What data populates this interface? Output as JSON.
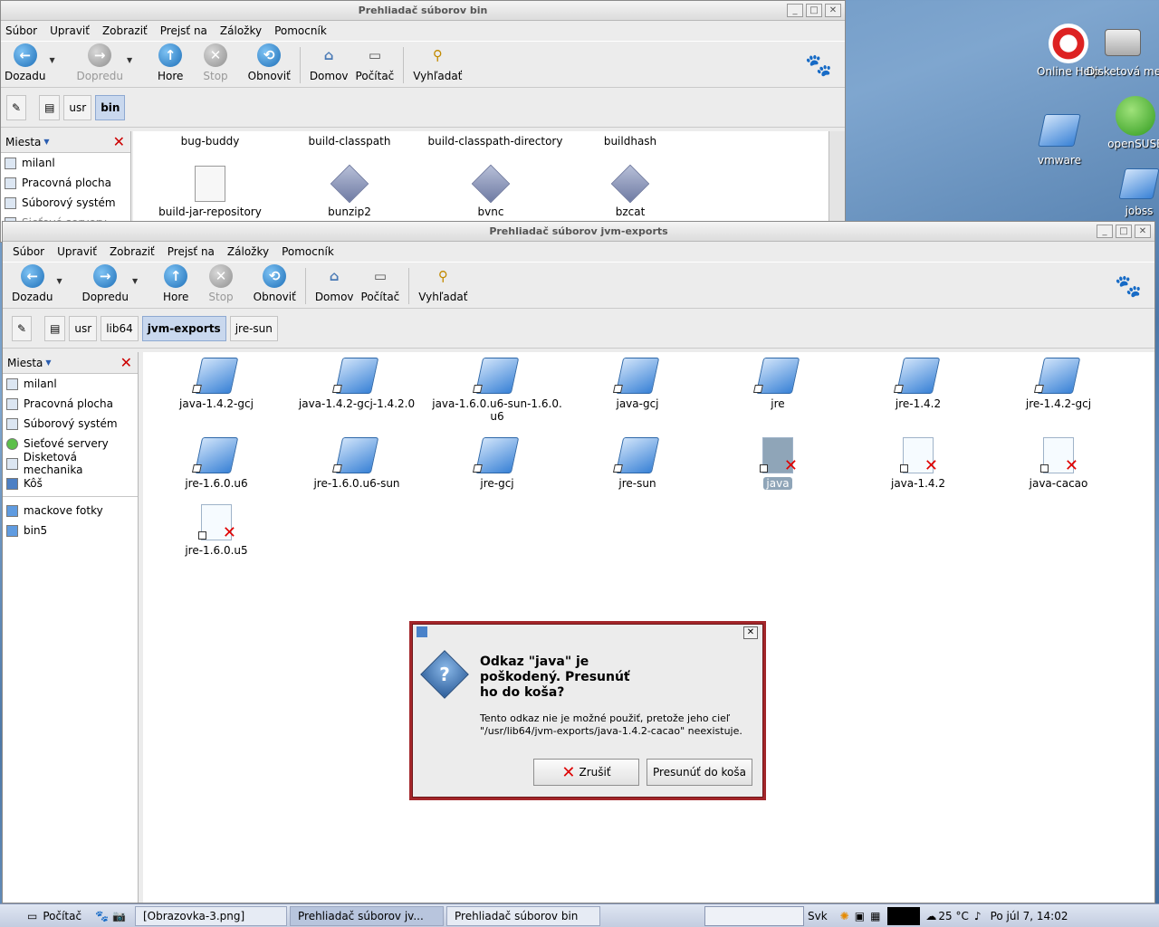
{
  "desktop": {
    "icons": [
      {
        "label": "Online Help",
        "icon": "lifebuoy-icon"
      },
      {
        "label": "Disketová mechanika",
        "icon": "floppy-icon"
      },
      {
        "label": "vmware",
        "icon": "folder-icon"
      },
      {
        "label": "openSUSE",
        "icon": "opensuse-icon"
      },
      {
        "label": "jobss",
        "icon": "folder-icon"
      }
    ],
    "icon_labels_rendered": {
      "online_help": "Online Help",
      "floppy": "Disketová med",
      "vmware": "vmware",
      "opensuse": "openSUSE",
      "jobss": "jobss"
    }
  },
  "window_bin": {
    "title": "Prehliadač súborov bin",
    "menu": [
      "Súbor",
      "Upraviť",
      "Zobraziť",
      "Prejsť na",
      "Záložky",
      "Pomocník"
    ],
    "toolbar": {
      "back": "Dozadu",
      "forward": "Dopredu",
      "up": "Hore",
      "stop": "Stop",
      "reload": "Obnoviť",
      "home": "Domov",
      "computer": "Počítač",
      "search": "Vyhľadať"
    },
    "crumbs": [
      "usr",
      "bin"
    ],
    "sidebar_title": "Miesta",
    "sidebar_items": [
      "milanl",
      "Pracovná plocha",
      "Súborový systém",
      "Sieťové servery"
    ],
    "files_top": [
      "bug-buddy",
      "build-classpath",
      "build-classpath-directory",
      "buildhash"
    ],
    "files": [
      "build-jar-repository",
      "bunzip2",
      "bvnc",
      "bzcat"
    ]
  },
  "window_jvm": {
    "title": "Prehliadač súborov jvm-exports",
    "menu": [
      "Súbor",
      "Upraviť",
      "Zobraziť",
      "Prejsť na",
      "Záložky",
      "Pomocník"
    ],
    "toolbar": {
      "back": "Dozadu",
      "forward": "Dopredu",
      "up": "Hore",
      "stop": "Stop",
      "reload": "Obnoviť",
      "home": "Domov",
      "computer": "Počítač",
      "search": "Vyhľadať"
    },
    "crumbs": [
      "usr",
      "lib64",
      "jvm-exports",
      "jre-sun"
    ],
    "sidebar_title": "Miesta",
    "sidebar_items": [
      "milanl",
      "Pracovná plocha",
      "Súborový systém",
      "Sieťové servery",
      "Disketová mechanika",
      "Kôš"
    ],
    "bookmarks": [
      "mackove fotky",
      "bin5"
    ],
    "files": [
      {
        "name": "java-1.4.2-gcj",
        "type": "folder"
      },
      {
        "name": "java-1.4.2-gcj-1.4.2.0",
        "type": "folder"
      },
      {
        "name": "java-1.6.0.u6-sun-1.6.0.u6",
        "type": "folder"
      },
      {
        "name": "java-gcj",
        "type": "folder"
      },
      {
        "name": "jre",
        "type": "folder"
      },
      {
        "name": "jre-1.4.2",
        "type": "folder"
      },
      {
        "name": "jre-1.4.2-gcj",
        "type": "folder"
      },
      {
        "name": "jre-1.6.0.u6",
        "type": "folder"
      },
      {
        "name": "jre-1.6.0.u6-sun",
        "type": "folder"
      },
      {
        "name": "jre-gcj",
        "type": "folder"
      },
      {
        "name": "jre-sun",
        "type": "folder"
      },
      {
        "name": "java",
        "type": "broken-selected"
      },
      {
        "name": "java-1.4.2",
        "type": "broken"
      },
      {
        "name": "java-cacao",
        "type": "broken"
      },
      {
        "name": "jre-1.6.0.u5",
        "type": "broken"
      }
    ]
  },
  "dialog": {
    "heading": "Odkaz \"java\" je poškodený. Presunúť ho do koša?",
    "body": "Tento odkaz nie je možné použiť, pretože jeho cieľ \"/usr/lib64/jvm-exports/java-1.4.2-cacao\" neexistuje.",
    "cancel": "Zrušiť",
    "trash": "Presunúť do koša"
  },
  "taskbar": {
    "start": "Počítač",
    "tasks": [
      "[Obrazovka-3.png]",
      "Prehliadač súborov jv...",
      "Prehliadač súborov bin"
    ],
    "keyboard": "Svk",
    "weather": "25 °C",
    "clock": "Po júl 7, 14:02"
  },
  "colors": {
    "dialog_border": "#a3262a",
    "selection": "#8fa5b8",
    "crumb_active": "#c9d8ee"
  }
}
